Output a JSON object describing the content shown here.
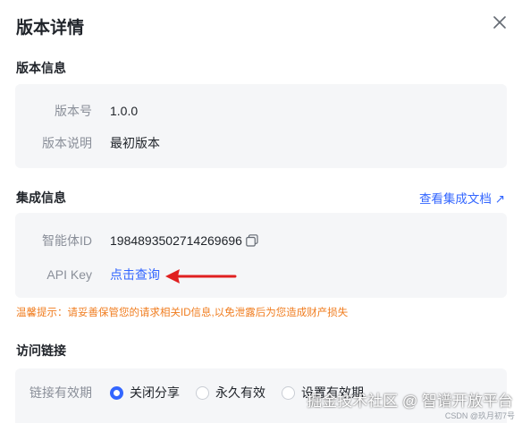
{
  "dialog": {
    "title": "版本详情",
    "close_icon": "close-icon"
  },
  "version_section": {
    "title": "版本信息",
    "rows": [
      {
        "label": "版本号",
        "value": "1.0.0"
      },
      {
        "label": "版本说明",
        "value": "最初版本"
      }
    ]
  },
  "integration_section": {
    "title": "集成信息",
    "doc_link": "查看集成文档 ↗",
    "agent_id_label": "智能体ID",
    "agent_id_value": "1984893502714269696",
    "api_key_label": "API Key",
    "api_key_link": "点击查询",
    "warning": "温馨提示：请妥善保管您的请求相关ID信息,以免泄露后为您造成财产损失"
  },
  "access_section": {
    "title": "访问链接",
    "validity_label": "链接有效期",
    "options": [
      {
        "label": "关闭分享",
        "checked": true
      },
      {
        "label": "永久有效",
        "checked": false
      },
      {
        "label": "设置有效期",
        "checked": false
      }
    ]
  },
  "watermark": {
    "main": "掘金技术社区 @ 智谱开放平台",
    "sub": "CSDN @玖月初7号"
  },
  "colors": {
    "accent": "#3366ff",
    "warning": "#f07c1e",
    "annotation_arrow": "#e02020"
  }
}
